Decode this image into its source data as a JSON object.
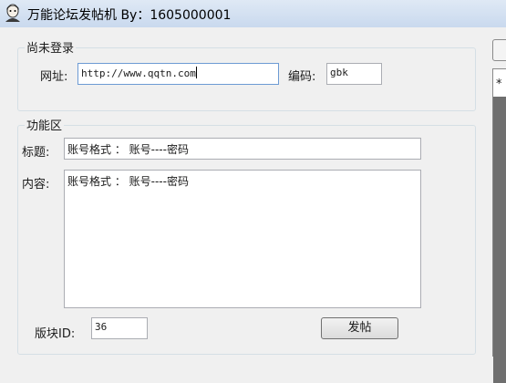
{
  "window": {
    "title": "万能论坛发帖机 By：1605000001",
    "icon": "user-avatar-icon"
  },
  "login_group": {
    "label": "尚未登录",
    "url_label": "网址:",
    "url_value": "http://www.qqtn.com",
    "encoding_label": "编码:",
    "encoding_value": "gbk"
  },
  "function_group": {
    "label": "功能区",
    "title_label": "标题:",
    "title_value": "账号格式 ：  账号----密码",
    "content_label": "内容:",
    "content_value": "账号格式 ：  账号----密码",
    "board_id_label": "版块ID:",
    "board_id_value": "36",
    "post_button_label": "发帖"
  },
  "right_panel": {
    "marker": "*"
  }
}
